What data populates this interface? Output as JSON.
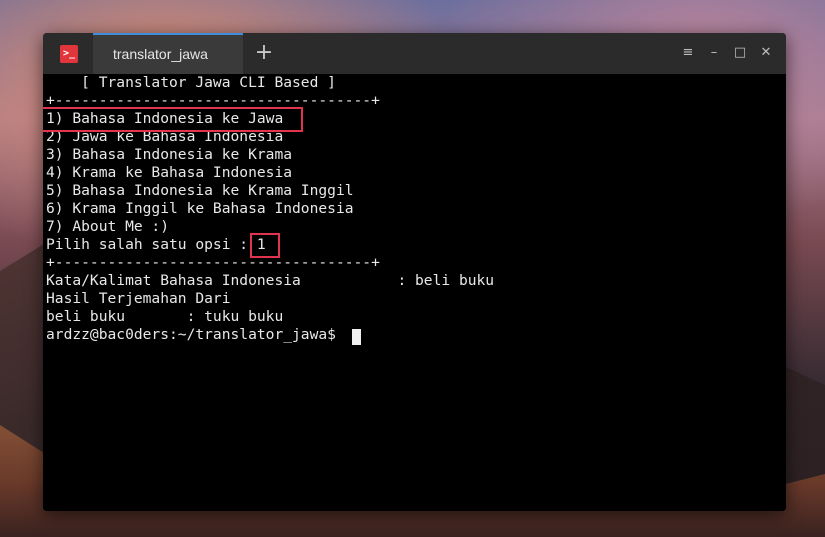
{
  "window": {
    "tab_title": "translator_jawa",
    "icon_glyph": ">_",
    "new_tab_glyph": "+",
    "controls": {
      "menu": "≡",
      "minimize": "–",
      "maximize": "□",
      "close": "✕"
    }
  },
  "terminal": {
    "lines": [
      "    [ Translator Jawa CLI Based ]",
      "+------------------------------------+",
      "1) Bahasa Indonesia ke Jawa",
      "2) Jawa ke Bahasa Indonesia",
      "3) Bahasa Indonesia ke Krama",
      "4) Krama ke Bahasa Indonesia",
      "5) Bahasa Indonesia ke Krama Inggil",
      "6) Krama Inggil ke Bahasa Indonesia",
      "7) About Me :)",
      "Pilih salah satu opsi : 1",
      "+------------------------------------+",
      "Kata/Kalimat Bahasa Indonesia           : beli buku",
      "Hasil Terjemahan Dari",
      "beli buku       : tuku buku",
      "ardzz@bac0ders:~/translator_jawa$ "
    ]
  },
  "colors": {
    "terminal_bg": "#000000",
    "terminal_fg": "#e8e8e8",
    "highlight": "#e0344f",
    "tab_accent": "#3f8ddb",
    "titlebar": "#2b2b2b"
  }
}
